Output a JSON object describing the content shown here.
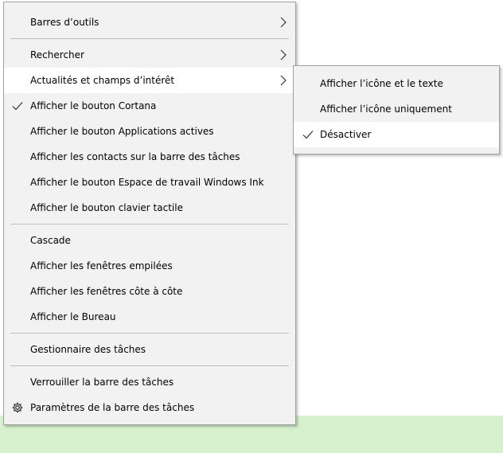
{
  "menu": {
    "toolbars": "Barres d’outils",
    "search": "Rechercher",
    "news": "Actualités et champs d’intérêt",
    "cortana": "Afficher le bouton Cortana",
    "task_view": "Afficher le bouton Applications actives",
    "contacts": "Afficher les contacts sur la barre des tâches",
    "ink": "Afficher le bouton Espace de travail Windows Ink",
    "keyboard": "Afficher le bouton clavier tactile",
    "cascade": "Cascade",
    "stacked": "Afficher les fenêtres empilées",
    "side_by_side": "Afficher les fenêtres côte à côte",
    "desktop": "Afficher le Bureau",
    "task_manager": "Gestionnaire des tâches",
    "lock": "Verrouiller la barre des tâches",
    "settings": "Paramètres de la barre des tâches"
  },
  "submenu": {
    "icon_and_text": "Afficher l’icône et le texte",
    "icon_only": "Afficher l’icône uniquement",
    "disable": "Désactiver"
  },
  "colors": {
    "menu_bg": "#f2f2f2",
    "highlight": "#ffffff",
    "desktop": "#d7f0ce"
  }
}
